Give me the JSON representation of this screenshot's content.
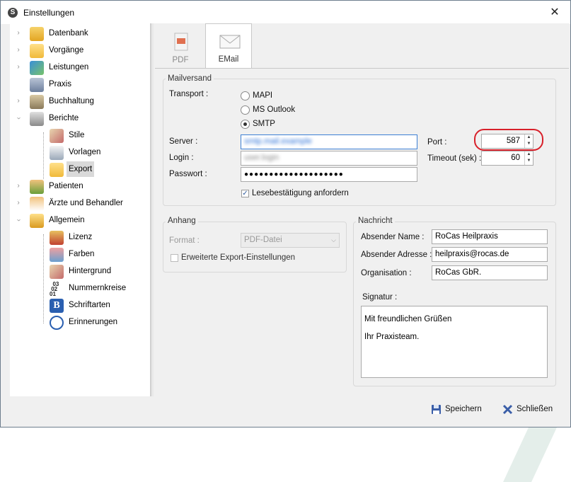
{
  "window": {
    "title": "Einstellungen",
    "close_glyph": "✕"
  },
  "tree": {
    "items": [
      {
        "label": "Datenbank",
        "icon": "database-search-icon"
      },
      {
        "label": "Vorgänge",
        "icon": "folder-icon"
      },
      {
        "label": "Leistungen",
        "icon": "services-icon"
      },
      {
        "label": "Praxis",
        "icon": "building-icon"
      },
      {
        "label": "Buchhaltung",
        "icon": "accounting-icon"
      },
      {
        "label": "Berichte",
        "icon": "printer-icon"
      },
      {
        "label": "Stile",
        "icon": "brush-icon"
      },
      {
        "label": "Vorlagen",
        "icon": "template-search-icon"
      },
      {
        "label": "Export",
        "icon": "folder-export-icon"
      },
      {
        "label": "Patienten",
        "icon": "patients-icon"
      },
      {
        "label": "Ärzte und Behandler",
        "icon": "doctor-icon"
      },
      {
        "label": "Allgemein",
        "icon": "general-icon"
      },
      {
        "label": "Lizenz",
        "icon": "license-icon"
      },
      {
        "label": "Farben",
        "icon": "colors-icon"
      },
      {
        "label": "Hintergrund",
        "icon": "background-icon"
      },
      {
        "label": "Nummernkreise",
        "icon": "numbers-icon"
      },
      {
        "label": "Schriftarten",
        "icon": "font-icon"
      },
      {
        "label": "Erinnerungen",
        "icon": "clock-icon"
      }
    ],
    "selected": "Export"
  },
  "tabs": [
    {
      "label": "PDF",
      "icon": "pdf-icon"
    },
    {
      "label": "EMail",
      "icon": "envelope-icon"
    }
  ],
  "mailversand": {
    "group_label": "Mailversand",
    "transport_label": "Transport :",
    "options": [
      "MAPI",
      "MS Outlook",
      "SMTP"
    ],
    "selected_option": "SMTP",
    "server_label": "Server :",
    "server_value": "smtp.mail.example",
    "login_label": "Login :",
    "login_value": "user.login",
    "password_label": "Passwort :",
    "password_value": "●●●●●●●●●●●●●●●●●●●●",
    "port_label": "Port :",
    "port_value": "587",
    "timeout_label": "Timeout (sek) :",
    "timeout_value": "60",
    "read_receipt_label": "Lesebestätigung anfordern",
    "read_receipt_checked": true
  },
  "anhang": {
    "group_label": "Anhang",
    "format_label": "Format :",
    "format_value": "PDF-Datei",
    "extended_label": "Erweiterte Export-Einstellungen"
  },
  "nachricht": {
    "group_label": "Nachricht",
    "sender_name_label": "Absender Name :",
    "sender_name_value": "RoCas Heilpraxis",
    "sender_address_label": "Absender Adresse :",
    "sender_address_value": "heilpraxis@rocas.de",
    "organisation_label": "Organisation :",
    "organisation_value": "RoCas GbR.",
    "signature_label": "Signatur :",
    "signature_line1": "Mit freundlichen Grüßen",
    "signature_line2": "Ihr Praxisteam."
  },
  "footer": {
    "save_label": "Speichern",
    "close_label": "Schließen"
  }
}
